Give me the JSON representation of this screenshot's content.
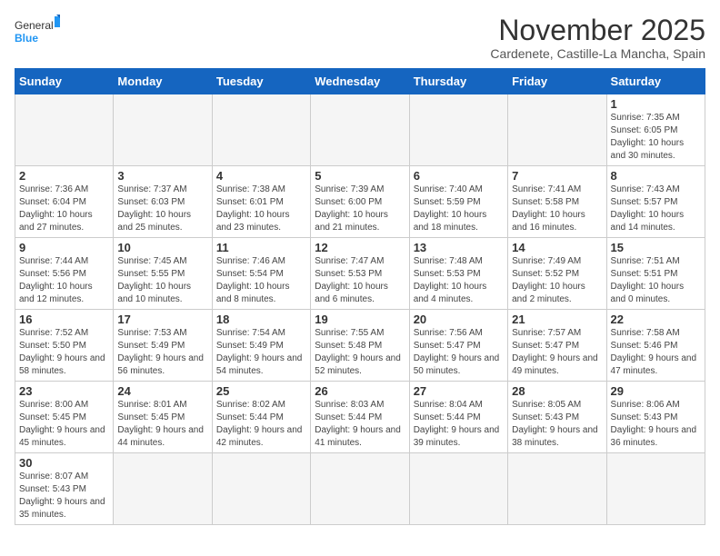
{
  "logo": {
    "text_general": "General",
    "text_blue": "Blue"
  },
  "title": "November 2025",
  "subtitle": "Cardenete, Castille-La Mancha, Spain",
  "weekdays": [
    "Sunday",
    "Monday",
    "Tuesday",
    "Wednesday",
    "Thursday",
    "Friday",
    "Saturday"
  ],
  "weeks": [
    [
      {
        "day": "",
        "info": ""
      },
      {
        "day": "",
        "info": ""
      },
      {
        "day": "",
        "info": ""
      },
      {
        "day": "",
        "info": ""
      },
      {
        "day": "",
        "info": ""
      },
      {
        "day": "",
        "info": ""
      },
      {
        "day": "1",
        "info": "Sunrise: 7:35 AM\nSunset: 6:05 PM\nDaylight: 10 hours and 30 minutes."
      }
    ],
    [
      {
        "day": "2",
        "info": "Sunrise: 7:36 AM\nSunset: 6:04 PM\nDaylight: 10 hours and 27 minutes."
      },
      {
        "day": "3",
        "info": "Sunrise: 7:37 AM\nSunset: 6:03 PM\nDaylight: 10 hours and 25 minutes."
      },
      {
        "day": "4",
        "info": "Sunrise: 7:38 AM\nSunset: 6:01 PM\nDaylight: 10 hours and 23 minutes."
      },
      {
        "day": "5",
        "info": "Sunrise: 7:39 AM\nSunset: 6:00 PM\nDaylight: 10 hours and 21 minutes."
      },
      {
        "day": "6",
        "info": "Sunrise: 7:40 AM\nSunset: 5:59 PM\nDaylight: 10 hours and 18 minutes."
      },
      {
        "day": "7",
        "info": "Sunrise: 7:41 AM\nSunset: 5:58 PM\nDaylight: 10 hours and 16 minutes."
      },
      {
        "day": "8",
        "info": "Sunrise: 7:43 AM\nSunset: 5:57 PM\nDaylight: 10 hours and 14 minutes."
      }
    ],
    [
      {
        "day": "9",
        "info": "Sunrise: 7:44 AM\nSunset: 5:56 PM\nDaylight: 10 hours and 12 minutes."
      },
      {
        "day": "10",
        "info": "Sunrise: 7:45 AM\nSunset: 5:55 PM\nDaylight: 10 hours and 10 minutes."
      },
      {
        "day": "11",
        "info": "Sunrise: 7:46 AM\nSunset: 5:54 PM\nDaylight: 10 hours and 8 minutes."
      },
      {
        "day": "12",
        "info": "Sunrise: 7:47 AM\nSunset: 5:53 PM\nDaylight: 10 hours and 6 minutes."
      },
      {
        "day": "13",
        "info": "Sunrise: 7:48 AM\nSunset: 5:53 PM\nDaylight: 10 hours and 4 minutes."
      },
      {
        "day": "14",
        "info": "Sunrise: 7:49 AM\nSunset: 5:52 PM\nDaylight: 10 hours and 2 minutes."
      },
      {
        "day": "15",
        "info": "Sunrise: 7:51 AM\nSunset: 5:51 PM\nDaylight: 10 hours and 0 minutes."
      }
    ],
    [
      {
        "day": "16",
        "info": "Sunrise: 7:52 AM\nSunset: 5:50 PM\nDaylight: 9 hours and 58 minutes."
      },
      {
        "day": "17",
        "info": "Sunrise: 7:53 AM\nSunset: 5:49 PM\nDaylight: 9 hours and 56 minutes."
      },
      {
        "day": "18",
        "info": "Sunrise: 7:54 AM\nSunset: 5:49 PM\nDaylight: 9 hours and 54 minutes."
      },
      {
        "day": "19",
        "info": "Sunrise: 7:55 AM\nSunset: 5:48 PM\nDaylight: 9 hours and 52 minutes."
      },
      {
        "day": "20",
        "info": "Sunrise: 7:56 AM\nSunset: 5:47 PM\nDaylight: 9 hours and 50 minutes."
      },
      {
        "day": "21",
        "info": "Sunrise: 7:57 AM\nSunset: 5:47 PM\nDaylight: 9 hours and 49 minutes."
      },
      {
        "day": "22",
        "info": "Sunrise: 7:58 AM\nSunset: 5:46 PM\nDaylight: 9 hours and 47 minutes."
      }
    ],
    [
      {
        "day": "23",
        "info": "Sunrise: 8:00 AM\nSunset: 5:45 PM\nDaylight: 9 hours and 45 minutes."
      },
      {
        "day": "24",
        "info": "Sunrise: 8:01 AM\nSunset: 5:45 PM\nDaylight: 9 hours and 44 minutes."
      },
      {
        "day": "25",
        "info": "Sunrise: 8:02 AM\nSunset: 5:44 PM\nDaylight: 9 hours and 42 minutes."
      },
      {
        "day": "26",
        "info": "Sunrise: 8:03 AM\nSunset: 5:44 PM\nDaylight: 9 hours and 41 minutes."
      },
      {
        "day": "27",
        "info": "Sunrise: 8:04 AM\nSunset: 5:44 PM\nDaylight: 9 hours and 39 minutes."
      },
      {
        "day": "28",
        "info": "Sunrise: 8:05 AM\nSunset: 5:43 PM\nDaylight: 9 hours and 38 minutes."
      },
      {
        "day": "29",
        "info": "Sunrise: 8:06 AM\nSunset: 5:43 PM\nDaylight: 9 hours and 36 minutes."
      }
    ],
    [
      {
        "day": "30",
        "info": "Sunrise: 8:07 AM\nSunset: 5:43 PM\nDaylight: 9 hours and 35 minutes."
      },
      {
        "day": "",
        "info": ""
      },
      {
        "day": "",
        "info": ""
      },
      {
        "day": "",
        "info": ""
      },
      {
        "day": "",
        "info": ""
      },
      {
        "day": "",
        "info": ""
      },
      {
        "day": "",
        "info": ""
      }
    ]
  ]
}
